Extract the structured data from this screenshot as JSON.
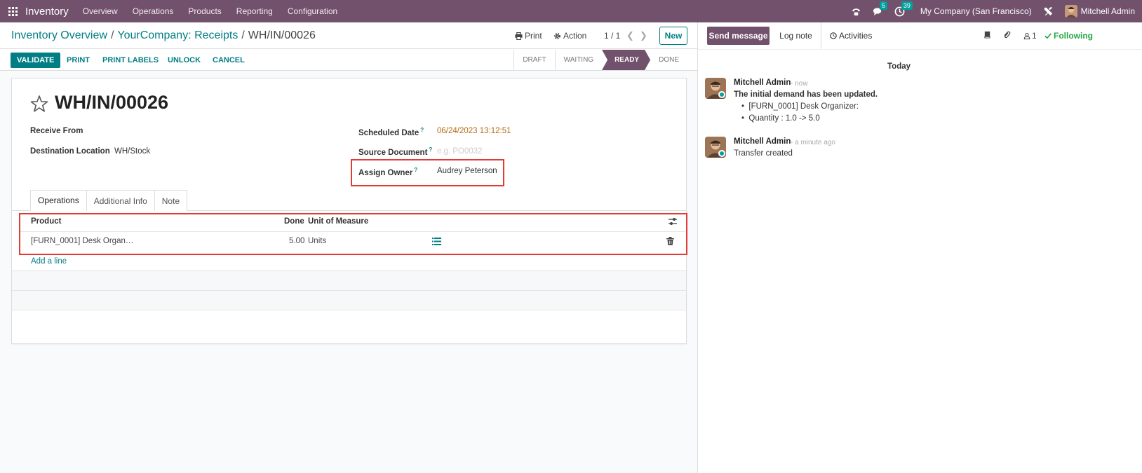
{
  "navbar": {
    "brand": "Inventory",
    "menus": [
      "Overview",
      "Operations",
      "Products",
      "Reporting",
      "Configuration"
    ],
    "messages_badge": "5",
    "activities_badge": "39",
    "company": "My Company (San Francisco)",
    "user": "Mitchell Admin"
  },
  "control_panel": {
    "breadcrumb": [
      "Inventory Overview",
      "YourCompany: Receipts",
      "WH/IN/00026"
    ],
    "separator": "/",
    "print_label": "Print",
    "action_label": "Action",
    "pager": "1 / 1",
    "new_label": "New"
  },
  "statusbar": {
    "buttons": [
      "VALIDATE",
      "PRINT",
      "PRINT LABELS",
      "UNLOCK",
      "CANCEL"
    ],
    "stages": [
      "DRAFT",
      "WAITING",
      "READY",
      "DONE"
    ],
    "active_stage": "READY"
  },
  "form": {
    "title": "WH/IN/00026",
    "receive_from_label": "Receive From",
    "receive_from_value": "",
    "destination_label": "Destination Location",
    "destination_value": "WH/Stock",
    "scheduled_date_label": "Scheduled Date",
    "scheduled_date_value": "06/24/2023 13:12:51",
    "source_document_label": "Source Document",
    "source_document_placeholder": "e.g. PO0032",
    "assign_owner_label": "Assign Owner",
    "assign_owner_value": "Audrey Peterson",
    "help_mark": "?"
  },
  "notebook": {
    "tabs": [
      "Operations",
      "Additional Info",
      "Note"
    ],
    "active_tab": "Operations",
    "columns": [
      "Product",
      "Done",
      "Unit of Measure"
    ],
    "rows": [
      {
        "product": "[FURN_0001] Desk Organ…",
        "done": "5.00",
        "uom": "Units"
      }
    ],
    "add_line": "Add a line"
  },
  "chatter": {
    "send_message": "Send message",
    "log_note": "Log note",
    "activities": "Activities",
    "followers_count": "1",
    "following": "Following",
    "date_separator": "Today",
    "messages": [
      {
        "author": "Mitchell Admin",
        "time": "- now",
        "title": "The initial demand has been updated.",
        "bullets": [
          "[FURN_0001] Desk Organizer:",
          "Quantity : 1.0 -> 5.0"
        ]
      },
      {
        "author": "Mitchell Admin",
        "time": "- a minute ago",
        "body": "Transfer created"
      }
    ]
  },
  "colors": {
    "brand": "#71516b",
    "accent": "#017e84",
    "highlight_box": "#e03b35",
    "following": "#28a745"
  }
}
